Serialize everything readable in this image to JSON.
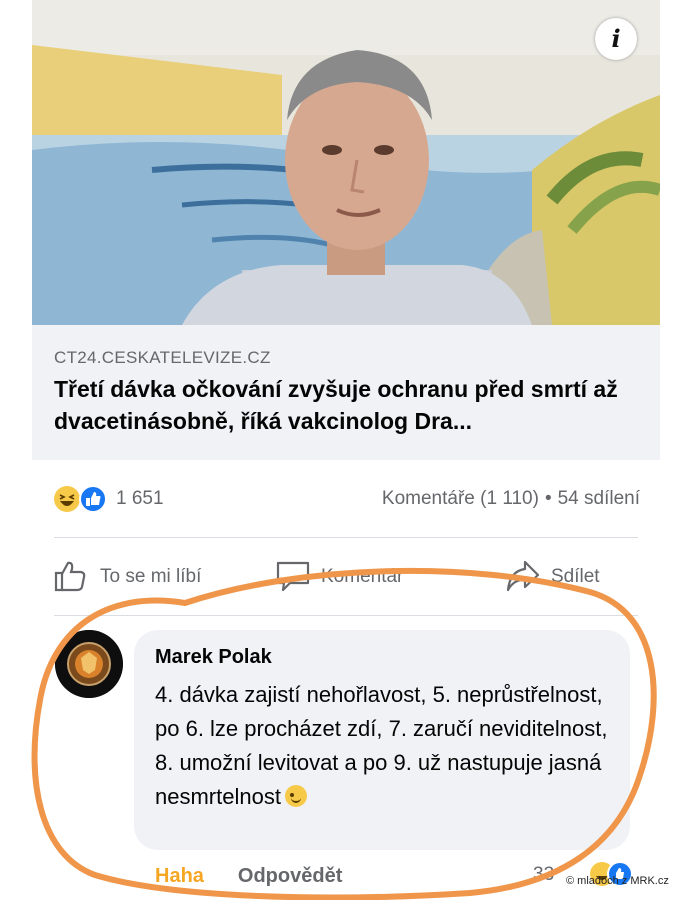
{
  "post": {
    "link": {
      "domain": "CT24.CESKATELEVIZE.CZ",
      "headline": "Třetí dávka očkování zvyšuje ochranu před smrtí až dvacetinásobně, říká vakcinolog Dra..."
    },
    "info_icon": "info-icon",
    "reactions": {
      "icons": [
        "haha-reaction-icon",
        "like-reaction-icon"
      ],
      "count": "1 651"
    },
    "comments_label": "Komentáře (1 110)",
    "separator": "•",
    "shares_label": "54 sdílení",
    "actions": {
      "like": "To se mi líbí",
      "comment": "Komentář",
      "share": "Sdílet"
    }
  },
  "comment": {
    "author": "Marek Polak",
    "text": "4. dávka zajistí nehořlavost, 5. neprůstřelnost, po 6. lze procházet zdí, 7. zaručí neviditelnost, 8. umožní levitovat a po 9. už nastupuje jasná nesmrtelnost",
    "emoji": "wink-emoji",
    "haha_label": "Haha",
    "reply_label": "Odpovědět",
    "reaction_count": "33"
  },
  "annotation": {
    "circle_color": "#f0964a"
  },
  "watermark": "© mladoch z MRK.cz"
}
